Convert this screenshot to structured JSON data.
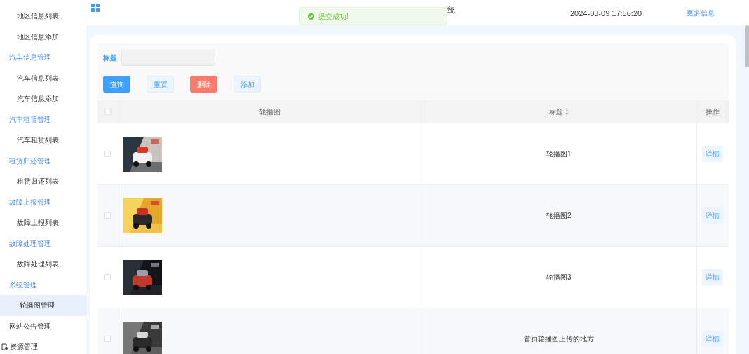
{
  "sidebar": {
    "groups": [
      {
        "kind": "group",
        "children": [
          {
            "label": "地区信息列表",
            "selected": false
          },
          {
            "label": "地区信息添加",
            "selected": false
          }
        ]
      },
      {
        "kind": "group",
        "label": "汽车信息管理",
        "children": [
          {
            "label": "汽车信息列表",
            "selected": false
          },
          {
            "label": "汽车信息添加",
            "selected": false
          }
        ]
      },
      {
        "kind": "group",
        "label": "汽车租赁管理",
        "children": [
          {
            "label": "汽车租赁列表",
            "selected": false
          }
        ]
      },
      {
        "kind": "group",
        "label": "租赁归还管理",
        "children": [
          {
            "label": "租赁归还列表",
            "selected": false
          }
        ]
      },
      {
        "kind": "group",
        "label": "故障上报管理",
        "children": [
          {
            "label": "故障上报列表",
            "selected": false
          }
        ]
      },
      {
        "kind": "group",
        "label": "故障处理管理",
        "children": [
          {
            "label": "故障处理列表",
            "selected": false
          }
        ]
      },
      {
        "kind": "group",
        "label": "系统管理",
        "children": [
          {
            "label": "轮播图管理",
            "selected": true
          }
        ]
      },
      {
        "kind": "page",
        "label": "网站公告管理"
      },
      {
        "kind": "page-with-icon",
        "label": "资源管理"
      }
    ]
  },
  "header": {
    "title": "统",
    "datetime": "2024-03-09 17:56:20",
    "more_link": "更多信息"
  },
  "toast": {
    "kind": "success",
    "message": "提交成功!"
  },
  "search": {
    "label": "标题"
  },
  "buttons": [
    {
      "label": "查询",
      "kind": "primary"
    },
    {
      "label": "重置",
      "kind": "plain"
    },
    {
      "label": "删除",
      "kind": "danger"
    },
    {
      "label": "添加",
      "kind": "plain"
    }
  ],
  "table": {
    "header_checked": false,
    "columns": [
      {
        "label": "轮播图",
        "sortable": false
      },
      {
        "label": "标题",
        "sortable": true
      },
      {
        "label": "操作",
        "sortable": false
      }
    ],
    "rows": [
      {
        "checked": false,
        "title": "轮播图1",
        "action": "详情"
      },
      {
        "checked": false,
        "title": "轮播图2",
        "action": "详情"
      },
      {
        "checked": false,
        "title": "轮播图3",
        "action": "详情"
      },
      {
        "checked": false,
        "title": "首页轮播图上传的地方",
        "action": "详情"
      }
    ]
  }
}
